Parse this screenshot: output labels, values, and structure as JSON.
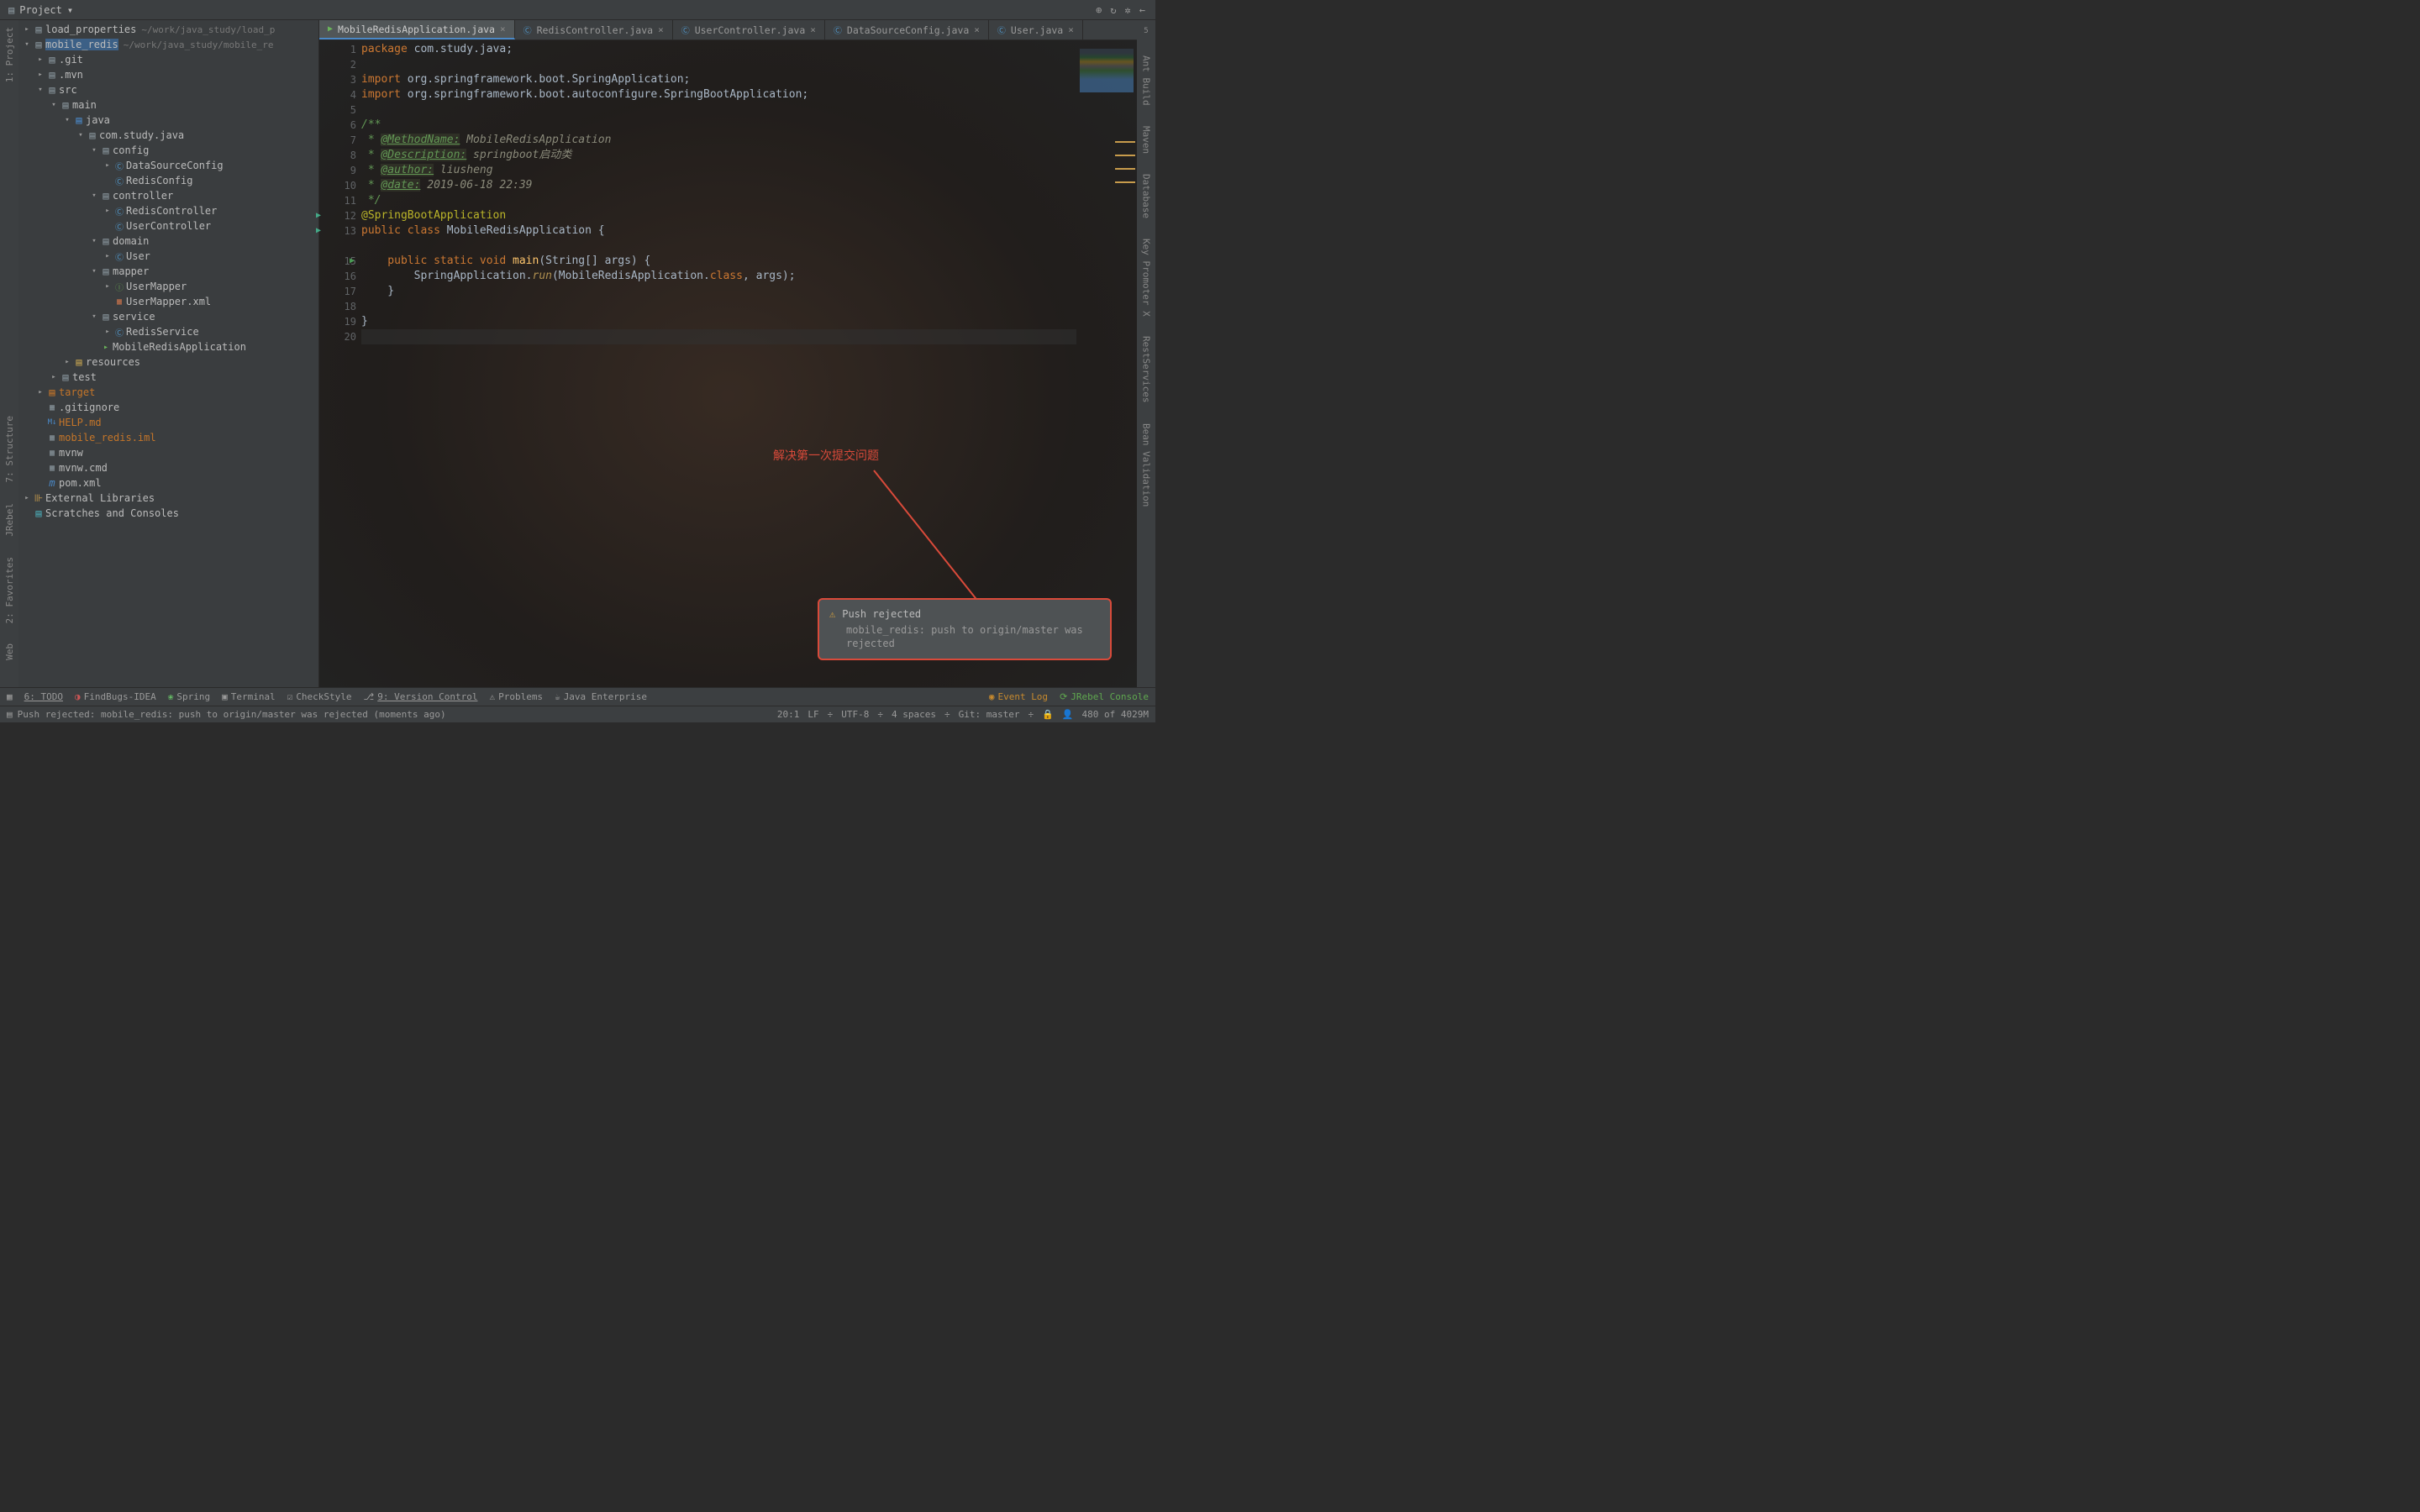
{
  "toolbar": {
    "project_label": "Project"
  },
  "left_rail": {
    "project": "1: Project",
    "structure": "7: Structure",
    "jrebel": "JRebel",
    "favorites": "2: Favorites",
    "web": "Web"
  },
  "right_rail": {
    "ant": "Ant Build",
    "maven": "Maven",
    "database": "Database",
    "keypromoter": "Key Promoter X",
    "rest": "RestServices",
    "bean": "Bean Validation",
    "count": "5"
  },
  "tree": {
    "r0": "load_properties",
    "r0_path": "~/work/java_study/load_p",
    "r1": "mobile_redis",
    "r1_path": "~/work/java_study/mobile_re",
    "r2": ".git",
    "r3": ".mvn",
    "r4": "src",
    "r5": "main",
    "r6": "java",
    "r7": "com.study.java",
    "r8": "config",
    "r9": "DataSourceConfig",
    "r10": "RedisConfig",
    "r11": "controller",
    "r12": "RedisController",
    "r13": "UserController",
    "r14": "domain",
    "r15": "User",
    "r16": "mapper",
    "r17": "UserMapper",
    "r18": "UserMapper.xml",
    "r19": "service",
    "r20": "RedisService",
    "r21": "MobileRedisApplication",
    "r22": "resources",
    "r23": "test",
    "r24": "target",
    "r25": ".gitignore",
    "r26": "HELP.md",
    "r27": "mobile_redis.iml",
    "r28": "mvnw",
    "r29": "mvnw.cmd",
    "r30": "pom.xml",
    "r31": "External Libraries",
    "r32": "Scratches and Consoles"
  },
  "tabs": {
    "t0": "MobileRedisApplication.java",
    "t1": "RedisController.java",
    "t2": "UserController.java",
    "t3": "DataSourceConfig.java",
    "t4": "User.java"
  },
  "code": {
    "l1_a": "package",
    "l1_b": " com.study.java;",
    "l3_a": "import",
    "l3_b": " org.springframework.boot.SpringApplication;",
    "l4_a": "import",
    "l4_b": " org.springframework.boot.autoconfigure.",
    "l4_c": "SpringBootApplication",
    "l4_d": ";",
    "l6": "/**",
    "l7_a": " * ",
    "l7_b": "@MethodName:",
    "l7_c": " MobileRedisApplication",
    "l8_a": " * ",
    "l8_b": "@Description:",
    "l8_c": " springboot启动类",
    "l9_a": " * ",
    "l9_b": "@author:",
    "l9_c": " liusheng",
    "l10_a": " * ",
    "l10_b": "@date:",
    "l10_c": " 2019-06-18 22:39",
    "l11": " */",
    "l12": "@SpringBootApplication",
    "l13_a": "public class ",
    "l13_b": "MobileRedisApplication",
    "l13_c": " {",
    "l15_a": "    public static void ",
    "l15_b": "main",
    "l15_c": "(String[] args) {",
    "l16_a": "        SpringApplication.",
    "l16_b": "run",
    "l16_c": "(MobileRedisApplication.",
    "l16_d": "class",
    "l16_e": ", args);",
    "l17": "    }",
    "l19": "}"
  },
  "line_numbers": [
    "1",
    "2",
    "3",
    "4",
    "5",
    "6",
    "7",
    "8",
    "9",
    "10",
    "11",
    "12",
    "13",
    "",
    "15",
    "16",
    "17",
    "18",
    "19",
    "20"
  ],
  "annotation": "解决第一次提交问题",
  "notification": {
    "title": "Push rejected",
    "msg": "mobile_redis: push to origin/master was rejected"
  },
  "bottom_tools": {
    "todo": "6: TODO",
    "findbugs": "FindBugs-IDEA",
    "spring": "Spring",
    "terminal": "Terminal",
    "checkstyle": "CheckStyle",
    "vcs": "9: Version Control",
    "problems": "Problems",
    "javaee": "Java Enterprise",
    "eventlog": "Event Log",
    "jrebel": "JRebel Console"
  },
  "status": {
    "msg": "Push rejected: mobile_redis: push to origin/master was rejected (moments ago)",
    "pos": "20:1",
    "lf": "LF",
    "enc": "UTF-8",
    "indent": "4 spaces",
    "git": "Git: master",
    "mem": "480 of 4029M"
  }
}
